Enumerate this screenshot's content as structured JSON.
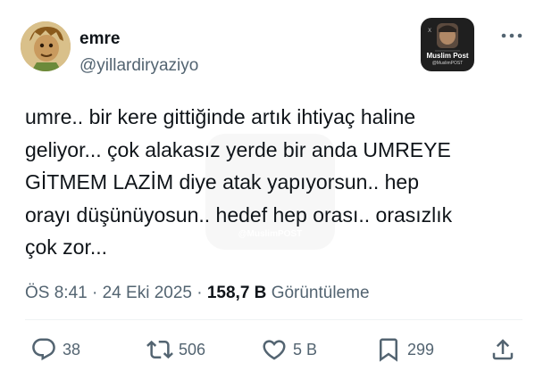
{
  "author": {
    "display_name": "emre",
    "handle": "@yillardiryaziyo"
  },
  "watermark_badge": {
    "name": "Muslim Post",
    "handle": "@MuslimPOST"
  },
  "watermark_center": "@MuslimPOST",
  "tweet": {
    "text": "umre.. bir kere gittiğinde artık ihtiyaç haline\ngeliyor... çok alakasız yerde bir anda UMREYE\nGİTMEM LAZİM diye atak yapıyorsun.. hep\norayı düşünüyosun.. hedef hep orası.. orasızlık\nçok zor..."
  },
  "meta": {
    "time": "ÖS 8:41",
    "separator": "·",
    "date": "24 Eki 2025",
    "views_count": "158,7 B",
    "views_label": "Görüntüleme"
  },
  "actions": {
    "replies": "38",
    "reposts": "506",
    "likes": "5 B",
    "bookmarks": "299"
  },
  "icons": {
    "more": "more-horizontal-icon",
    "reply": "reply-icon",
    "repost": "repost-icon",
    "like": "heart-icon",
    "bookmark": "bookmark-icon",
    "share": "share-icon"
  },
  "colors": {
    "text_primary": "#0f1419",
    "text_secondary": "#536471",
    "divider": "#eff3f4"
  }
}
